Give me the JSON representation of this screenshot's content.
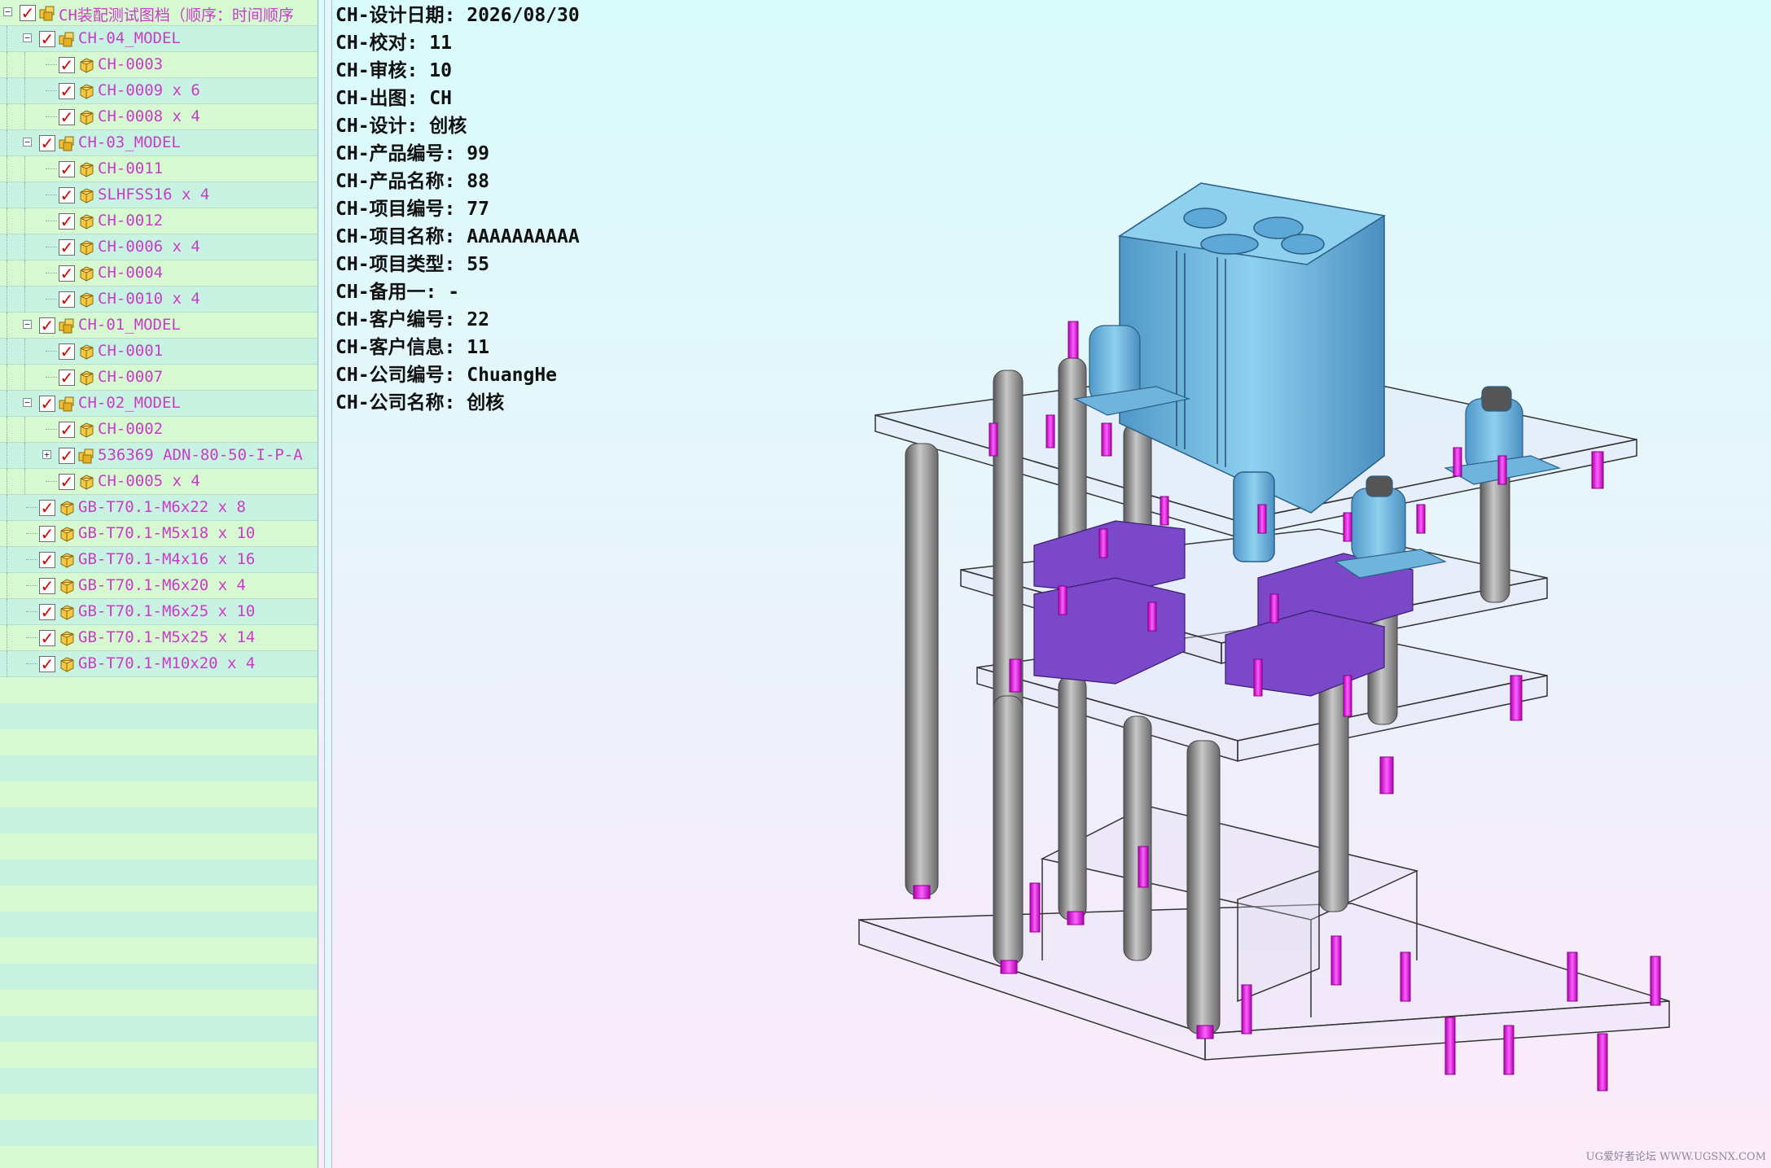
{
  "tree": {
    "rows": [
      {
        "label": "CH装配测试图档（顺序：时间顺序",
        "level": 0,
        "expander": "minus",
        "icon": "assembly"
      },
      {
        "label": "CH-04_MODEL",
        "level": 1,
        "expander": "minus",
        "icon": "assembly"
      },
      {
        "label": "CH-0003",
        "level": 2,
        "expander": "",
        "icon": "part"
      },
      {
        "label": "CH-0009 x 6",
        "level": 2,
        "expander": "",
        "icon": "part"
      },
      {
        "label": "CH-0008 x 4",
        "level": 2,
        "expander": "",
        "icon": "part"
      },
      {
        "label": "CH-03_MODEL",
        "level": 1,
        "expander": "minus",
        "icon": "assembly"
      },
      {
        "label": "CH-0011",
        "level": 2,
        "expander": "",
        "icon": "part"
      },
      {
        "label": "SLHFSS16 x 4",
        "level": 2,
        "expander": "",
        "icon": "part"
      },
      {
        "label": "CH-0012",
        "level": 2,
        "expander": "",
        "icon": "part"
      },
      {
        "label": "CH-0006 x 4",
        "level": 2,
        "expander": "",
        "icon": "part"
      },
      {
        "label": "CH-0004",
        "level": 2,
        "expander": "",
        "icon": "part"
      },
      {
        "label": "CH-0010 x 4",
        "level": 2,
        "expander": "",
        "icon": "part"
      },
      {
        "label": "CH-01_MODEL",
        "level": 1,
        "expander": "minus",
        "icon": "assembly"
      },
      {
        "label": "CH-0001",
        "level": 2,
        "expander": "",
        "icon": "part"
      },
      {
        "label": "CH-0007",
        "level": 2,
        "expander": "",
        "icon": "part"
      },
      {
        "label": "CH-02_MODEL",
        "level": 1,
        "expander": "minus",
        "icon": "assembly"
      },
      {
        "label": "CH-0002",
        "level": 2,
        "expander": "",
        "icon": "part"
      },
      {
        "label": "536369 ADN-80-50-I-P-A",
        "level": 2,
        "expander": "plus",
        "icon": "assembly"
      },
      {
        "label": "CH-0005 x 4",
        "level": 2,
        "expander": "",
        "icon": "part"
      },
      {
        "label": "GB-T70.1-M6x22 x 8",
        "level": 1,
        "expander": "",
        "icon": "part"
      },
      {
        "label": "GB-T70.1-M5x18 x 10",
        "level": 1,
        "expander": "",
        "icon": "part"
      },
      {
        "label": "GB-T70.1-M4x16 x 16",
        "level": 1,
        "expander": "",
        "icon": "part"
      },
      {
        "label": "GB-T70.1-M6x20 x 4",
        "level": 1,
        "expander": "",
        "icon": "part"
      },
      {
        "label": "GB-T70.1-M6x25 x 10",
        "level": 1,
        "expander": "",
        "icon": "part"
      },
      {
        "label": "GB-T70.1-M5x25 x 14",
        "level": 1,
        "expander": "",
        "icon": "part"
      },
      {
        "label": "GB-T70.1-M10x20 x 4",
        "level": 1,
        "expander": "",
        "icon": "part"
      }
    ],
    "checkmark": "✓"
  },
  "attributes": [
    "CH-设计日期: 2026/08/30",
    "CH-校对: 11",
    "CH-审核: 10",
    "CH-出图: CH",
    "CH-设计: 创核",
    "CH-产品编号: 99",
    "CH-产品名称: 88",
    "CH-项目编号: 77",
    "CH-项目名称: AAAAAAAAAA",
    "CH-项目类型: 55",
    "CH-备用一: -",
    "CH-客户编号: 22",
    "CH-客户信息: 11",
    "CH-公司编号: ChuangHe",
    "CH-公司名称: 创核"
  ],
  "colors": {
    "cylinder_blue": "#6fb4dc",
    "block_purple": "#7a48c8",
    "screw_magenta": "#e020e0",
    "rod_gray": "#8c8c8c",
    "label_pink": "#c83cc8",
    "check_red": "#d40000"
  },
  "watermark": "UG爱好者论坛 WWW.UGSNX.COM"
}
